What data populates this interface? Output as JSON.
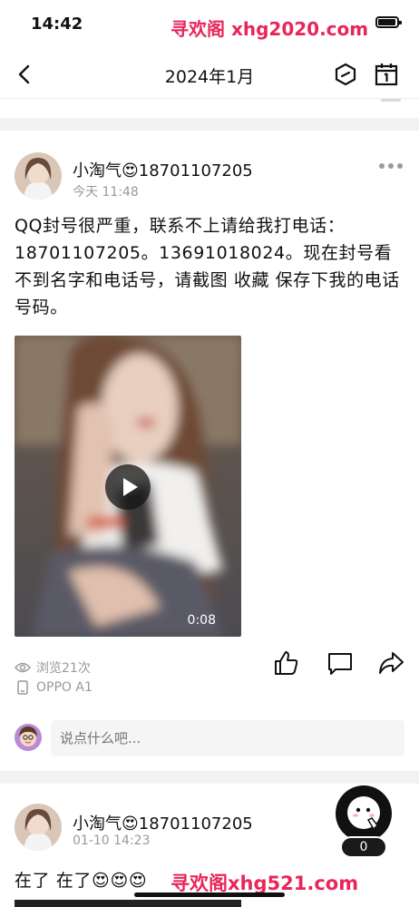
{
  "status_bar": {
    "time": "14:42"
  },
  "watermark_top": "寻欢阁 xhg2020.com",
  "nav": {
    "title": "2024年1月"
  },
  "posts": [
    {
      "author": "小淘气😍18701107205",
      "time": "今天 11:48",
      "text": "QQ封号很严重，联系不上请给我打电话：18701107205。13691018024。现在封号看不到名字和电话号，请截图 收藏 保存下我的电话号码。",
      "video_duration": "0:08",
      "views": "浏览21次",
      "device": "OPPO A1"
    },
    {
      "author": "小淘气😍18701107205",
      "time": "01-10 14:23",
      "text": "在了 在了😍😍😍"
    }
  ],
  "comment": {
    "placeholder": "说点什么吧..."
  },
  "float_count": "0",
  "watermark_bottom": "寻欢阁xhg521.com",
  "colors": {
    "watermark": "#e8265a",
    "meta_gray": "#999999",
    "separator": "#f2f2f2"
  }
}
